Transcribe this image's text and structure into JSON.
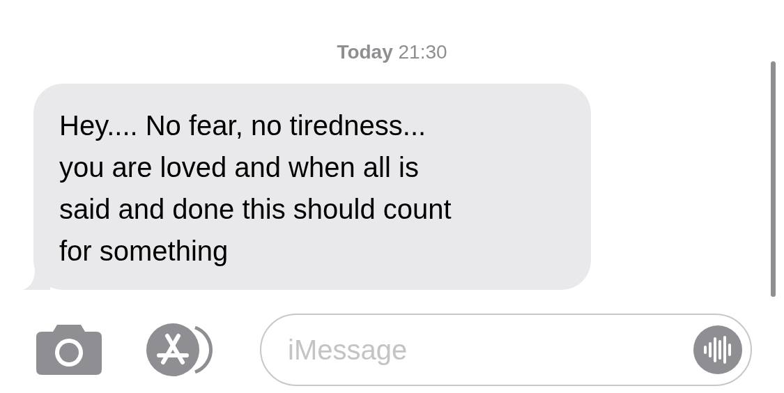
{
  "timestamp": "**Today** 21:30",
  "messages": [
    {
      "kind": "received",
      "text": "Hey.... No fear, no tiredness...\nyou are loved and when all is\nsaid and done this should count\nfor something"
    }
  ],
  "composer": {
    "placeholder": "iMessage"
  }
}
